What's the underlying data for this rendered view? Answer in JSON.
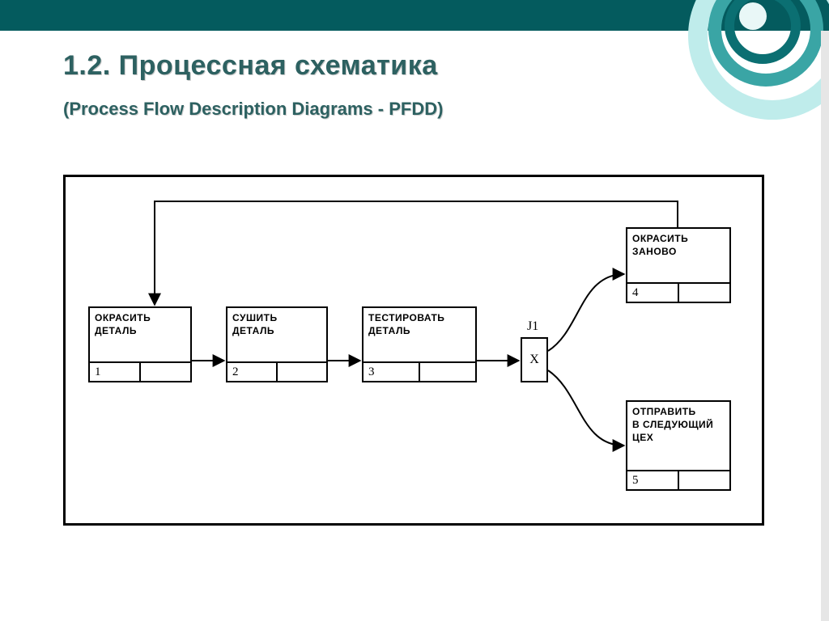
{
  "header": {
    "title": "1.2. Процессная схематика",
    "subtitle": "(Process Flow Description Diagrams - PFDD)"
  },
  "diagram": {
    "junction": {
      "label": "J1",
      "symbol": "X"
    },
    "uow": {
      "b1": {
        "title_l1": "ОКРАСИТЬ",
        "title_l2": "ДЕТАЛЬ",
        "num": "1"
      },
      "b2": {
        "title_l1": "СУШИТЬ",
        "title_l2": "ДЕТАЛЬ",
        "num": "2"
      },
      "b3": {
        "title_l1": "ТЕСТИРОВАТЬ",
        "title_l2": "ДЕТАЛЬ",
        "num": "3"
      },
      "b4": {
        "title_l1": "ОКРАСИТЬ",
        "title_l2": "ЗАНОВО",
        "num": "4"
      },
      "b5": {
        "title_l1": "ОТПРАВИТЬ",
        "title_l2": "В СЛЕДУЮЩИЙ",
        "title_l3": "ЦЕХ",
        "num": "5"
      }
    }
  }
}
